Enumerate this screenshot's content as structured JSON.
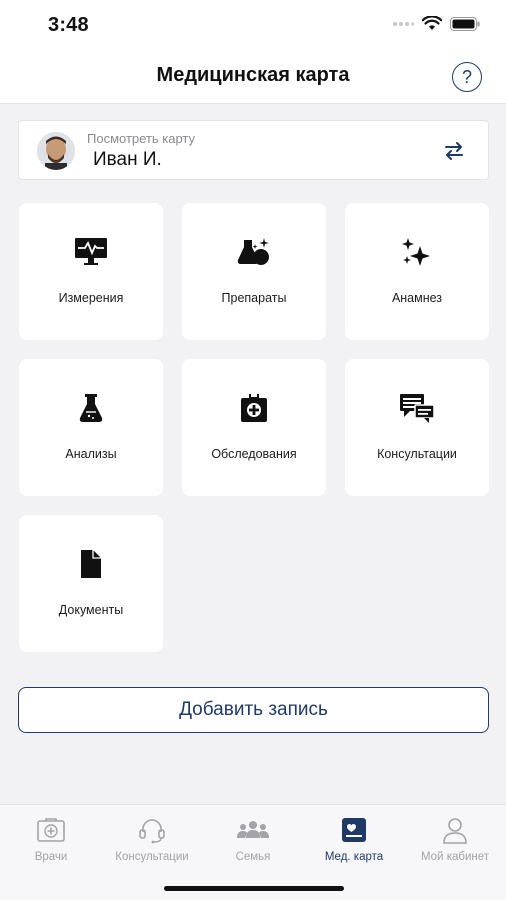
{
  "status": {
    "time": "3:48"
  },
  "header": {
    "title": "Медицинская карта",
    "help_label": "?"
  },
  "patient": {
    "label": "Посмотреть карту",
    "name": "Иван И."
  },
  "tiles": [
    {
      "label": "Измерения",
      "icon": "monitor-pulse-icon"
    },
    {
      "label": "Препараты",
      "icon": "flask-sparkle-icon"
    },
    {
      "label": "Анамнез",
      "icon": "sparkles-icon"
    },
    {
      "label": "Анализы",
      "icon": "lab-flask-icon"
    },
    {
      "label": "Обследования",
      "icon": "medical-case-icon"
    },
    {
      "label": "Консультации",
      "icon": "chat-bubbles-icon"
    },
    {
      "label": "Документы",
      "icon": "document-icon"
    }
  ],
  "add_button": {
    "label": "Добавить запись"
  },
  "tabbar": {
    "items": [
      {
        "label": "Врачи",
        "icon": "medkit-icon",
        "active": false
      },
      {
        "label": "Консультации",
        "icon": "headset-icon",
        "active": false
      },
      {
        "label": "Семья",
        "icon": "people-icon",
        "active": false
      },
      {
        "label": "Мед. карта",
        "icon": "med-card-icon",
        "active": true
      },
      {
        "label": "Мой кабинет",
        "icon": "person-icon",
        "active": false
      }
    ]
  },
  "colors": {
    "accent": "#1f3a66",
    "background": "#f2f2f4",
    "inactive": "#a3a3a8"
  }
}
